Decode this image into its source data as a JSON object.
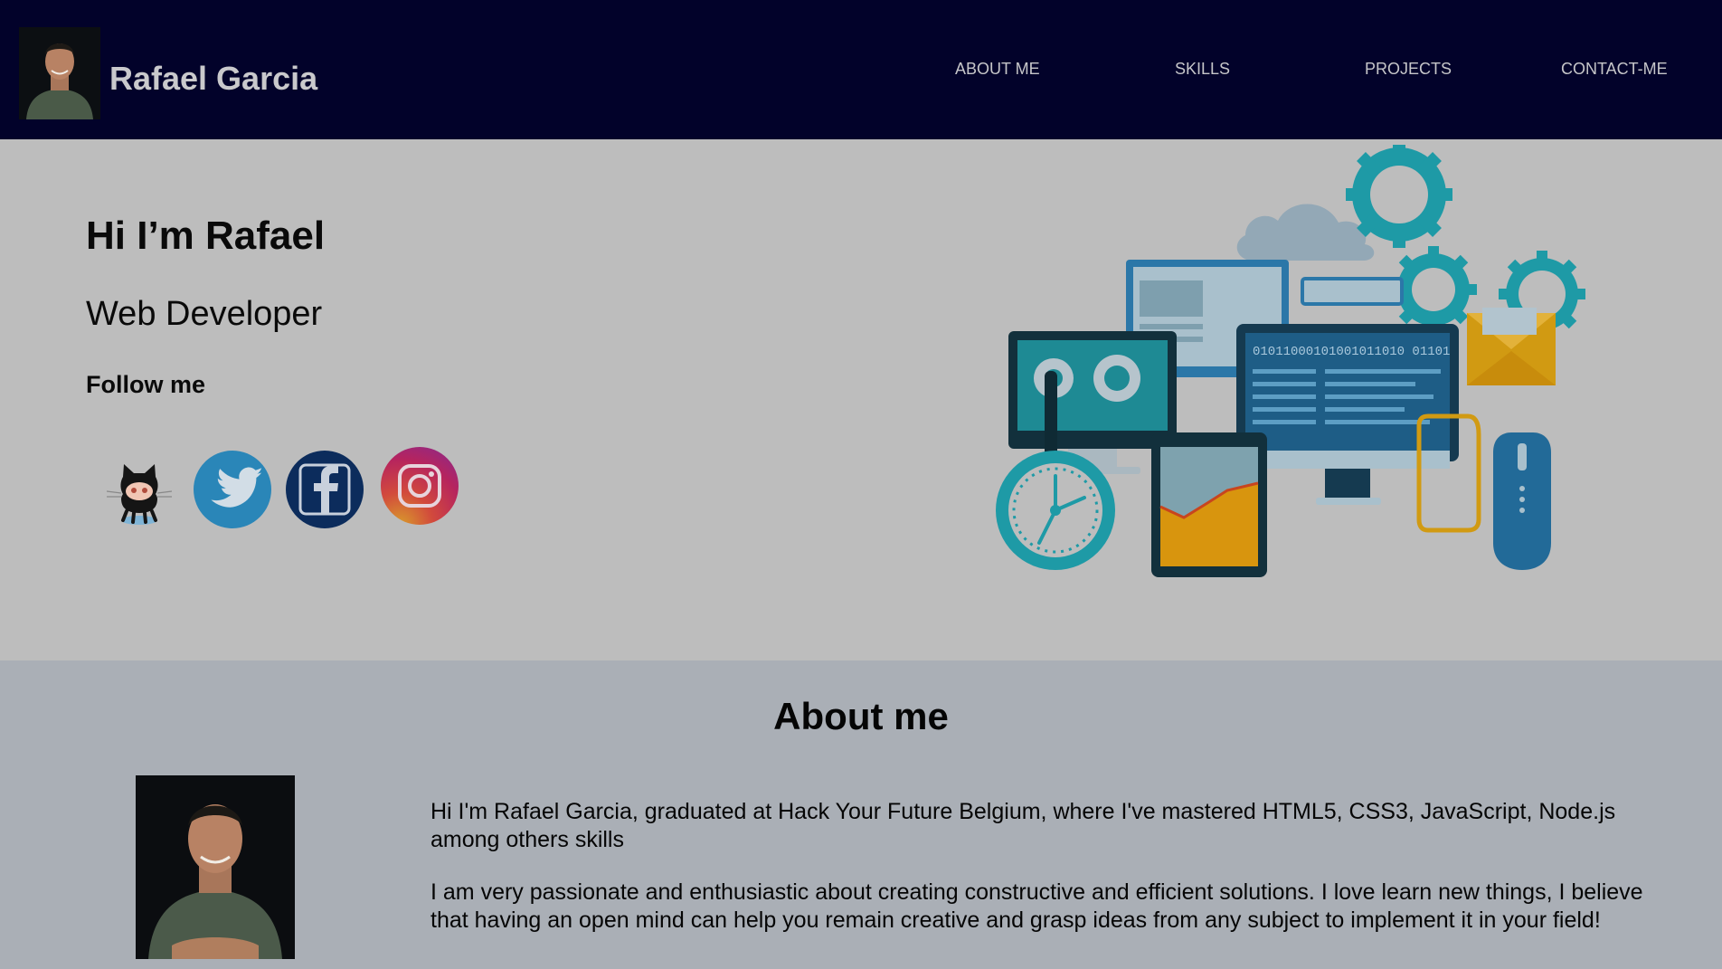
{
  "header": {
    "brand_name": "Rafael Garcia",
    "nav": [
      "ABOUT ME",
      "SKILLS",
      "PROJECTS",
      "CONTACT-ME"
    ]
  },
  "hero": {
    "greeting": "Hi I’m Rafael",
    "role": "Web Developer",
    "follow_label": "Follow me",
    "social": [
      "github-icon",
      "twitter-icon",
      "facebook-icon",
      "instagram-icon"
    ],
    "illustration_text": "01011000101001011010 01101"
  },
  "about": {
    "title": "About me",
    "paragraphs": [
      "Hi I'm Rafael Garcia, graduated at Hack Your Future Belgium, where I've mastered HTML5, CSS3, JavaScript, Node.js among others skills",
      "I am very passionate and enthusiastic about creating constructive and efficient solutions. I love learn new things, I believe that having an open mind can help you remain creative and grasp ideas from any subject to implement it in your field!"
    ]
  },
  "colors": {
    "header_bg": "#02022a",
    "hero_bg": "#bdbdbd",
    "about_bg": "#aaafb6",
    "nav_text": "#c6c6c9"
  }
}
